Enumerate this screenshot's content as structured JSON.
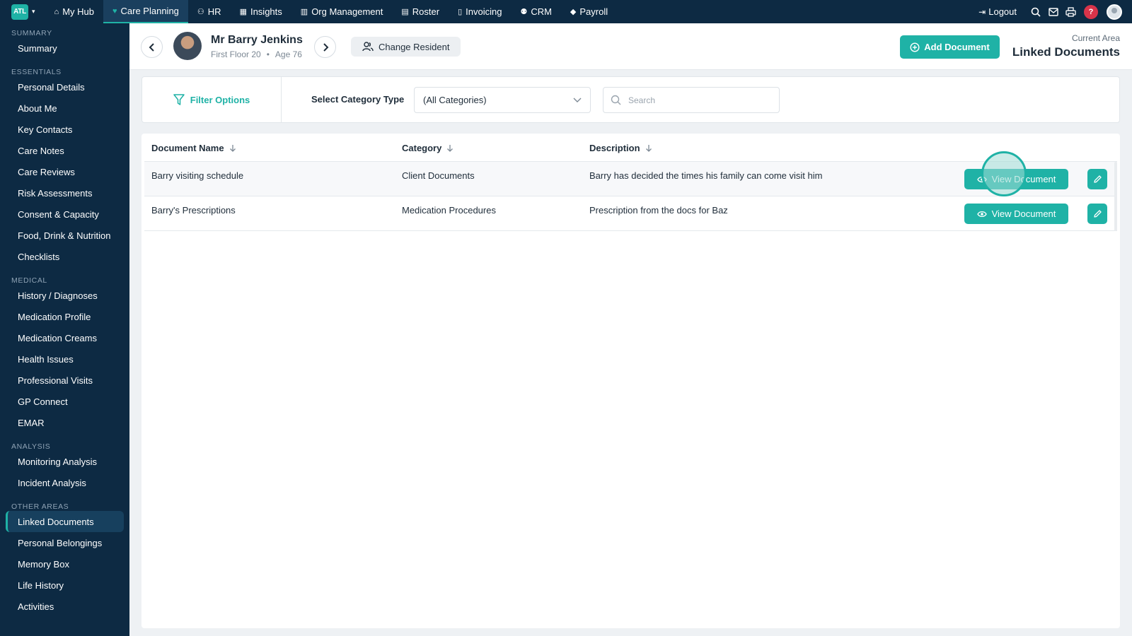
{
  "app": {
    "logo_text": "ATL"
  },
  "topnav": {
    "items": [
      {
        "label": "My Hub",
        "icon": "home-icon",
        "active": false
      },
      {
        "label": "Care Planning",
        "icon": "heart-icon",
        "active": true
      },
      {
        "label": "HR",
        "icon": "people-icon",
        "active": false
      },
      {
        "label": "Insights",
        "icon": "chart-icon",
        "active": false
      },
      {
        "label": "Org Management",
        "icon": "building-icon",
        "active": false
      },
      {
        "label": "Roster",
        "icon": "calendar-icon",
        "active": false
      },
      {
        "label": "Invoicing",
        "icon": "document-icon",
        "active": false
      },
      {
        "label": "CRM",
        "icon": "user-group-icon",
        "active": false
      },
      {
        "label": "Payroll",
        "icon": "tag-icon",
        "active": false
      }
    ],
    "logout_label": "Logout",
    "help_label": "?"
  },
  "sidebar": {
    "sections": [
      {
        "title": "SUMMARY",
        "items": [
          "Summary"
        ]
      },
      {
        "title": "ESSENTIALS",
        "items": [
          "Personal Details",
          "About Me",
          "Key Contacts",
          "Care Notes",
          "Care Reviews",
          "Risk Assessments",
          "Consent & Capacity",
          "Food, Drink & Nutrition",
          "Checklists"
        ]
      },
      {
        "title": "MEDICAL",
        "items": [
          "History / Diagnoses",
          "Medication Profile",
          "Medication Creams",
          "Health Issues",
          "Professional Visits",
          "GP Connect",
          "EMAR"
        ]
      },
      {
        "title": "ANALYSIS",
        "items": [
          "Monitoring Analysis",
          "Incident Analysis"
        ]
      },
      {
        "title": "OTHER AREAS",
        "items": [
          "Linked Documents",
          "Personal Belongings",
          "Memory Box",
          "Life History",
          "Activities"
        ]
      }
    ],
    "active_item": "Linked Documents"
  },
  "resident": {
    "name": "Mr Barry Jenkins",
    "location": "First Floor 20",
    "age": "Age 76",
    "change_label": "Change Resident"
  },
  "header": {
    "add_label": "Add Document",
    "current_area_label": "Current Area",
    "current_area_value": "Linked Documents"
  },
  "filters": {
    "filter_options_label": "Filter Options",
    "category_label": "Select Category Type",
    "category_value": "(All Categories)",
    "search_placeholder": "Search"
  },
  "table": {
    "columns": [
      "Document Name",
      "Category",
      "Description"
    ],
    "rows": [
      {
        "name": "Barry visiting schedule",
        "category": "Client Documents",
        "description": "Barry has decided the times his family can come visit him",
        "view_label": "View Document"
      },
      {
        "name": "Barry's Prescriptions",
        "category": "Medication Procedures",
        "description": "Prescription from the docs for Baz",
        "view_label": "View Document"
      }
    ]
  },
  "colors": {
    "accent": "#1fb2a6",
    "nav_bg": "#0d2a43",
    "alert": "#d9344a"
  }
}
